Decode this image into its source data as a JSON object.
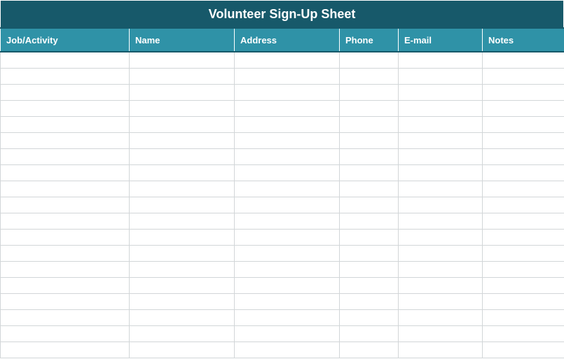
{
  "title": "Volunteer Sign-Up Sheet",
  "columns": [
    {
      "key": "job",
      "label": "Job/Activity"
    },
    {
      "key": "name",
      "label": "Name"
    },
    {
      "key": "address",
      "label": "Address"
    },
    {
      "key": "phone",
      "label": "Phone"
    },
    {
      "key": "email",
      "label": "E-mail"
    },
    {
      "key": "notes",
      "label": "Notes"
    }
  ],
  "rows": [
    {
      "job": "",
      "name": "",
      "address": "",
      "phone": "",
      "email": "",
      "notes": ""
    },
    {
      "job": "",
      "name": "",
      "address": "",
      "phone": "",
      "email": "",
      "notes": ""
    },
    {
      "job": "",
      "name": "",
      "address": "",
      "phone": "",
      "email": "",
      "notes": ""
    },
    {
      "job": "",
      "name": "",
      "address": "",
      "phone": "",
      "email": "",
      "notes": ""
    },
    {
      "job": "",
      "name": "",
      "address": "",
      "phone": "",
      "email": "",
      "notes": ""
    },
    {
      "job": "",
      "name": "",
      "address": "",
      "phone": "",
      "email": "",
      "notes": ""
    },
    {
      "job": "",
      "name": "",
      "address": "",
      "phone": "",
      "email": "",
      "notes": ""
    },
    {
      "job": "",
      "name": "",
      "address": "",
      "phone": "",
      "email": "",
      "notes": ""
    },
    {
      "job": "",
      "name": "",
      "address": "",
      "phone": "",
      "email": "",
      "notes": ""
    },
    {
      "job": "",
      "name": "",
      "address": "",
      "phone": "",
      "email": "",
      "notes": ""
    },
    {
      "job": "",
      "name": "",
      "address": "",
      "phone": "",
      "email": "",
      "notes": ""
    },
    {
      "job": "",
      "name": "",
      "address": "",
      "phone": "",
      "email": "",
      "notes": ""
    },
    {
      "job": "",
      "name": "",
      "address": "",
      "phone": "",
      "email": "",
      "notes": ""
    },
    {
      "job": "",
      "name": "",
      "address": "",
      "phone": "",
      "email": "",
      "notes": ""
    },
    {
      "job": "",
      "name": "",
      "address": "",
      "phone": "",
      "email": "",
      "notes": ""
    },
    {
      "job": "",
      "name": "",
      "address": "",
      "phone": "",
      "email": "",
      "notes": ""
    },
    {
      "job": "",
      "name": "",
      "address": "",
      "phone": "",
      "email": "",
      "notes": ""
    },
    {
      "job": "",
      "name": "",
      "address": "",
      "phone": "",
      "email": "",
      "notes": ""
    },
    {
      "job": "",
      "name": "",
      "address": "",
      "phone": "",
      "email": "",
      "notes": ""
    }
  ],
  "colors": {
    "title_bg": "#17596a",
    "header_bg": "#2f92a7",
    "grid": "#d2d6d8",
    "text_on_dark": "#ffffff"
  }
}
